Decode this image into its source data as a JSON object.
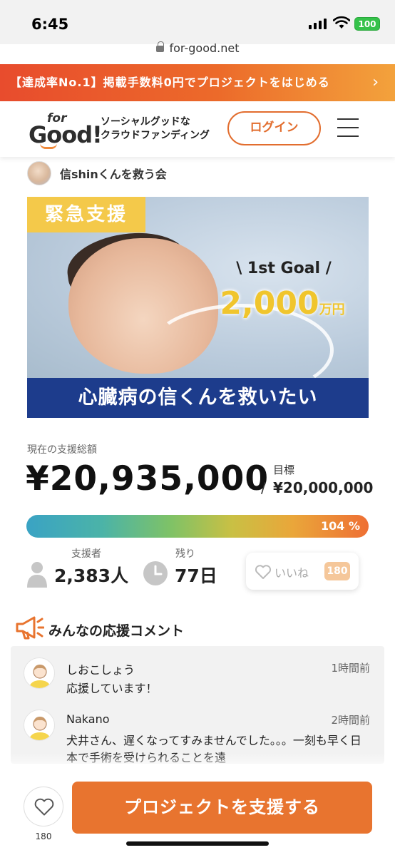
{
  "status_bar": {
    "time": "6:45",
    "battery": "100"
  },
  "browser": {
    "url": "for-good.net"
  },
  "promo": {
    "text": "【達成率No.1】掲載手数料0円でプロジェクトをはじめる",
    "chevron": "›"
  },
  "header": {
    "logo_for": "for",
    "logo_good": "Good!",
    "tagline_1": "ソーシャルグッドな",
    "tagline_2": "クラウドファンディング",
    "login_label": "ログイン"
  },
  "project": {
    "owner": "信shinくんを救う会",
    "hero": {
      "badge": "緊急支援",
      "goal_label": "\\ 1st Goal /",
      "goal_amount": "2,000",
      "goal_unit": "万円",
      "caption": "心臓病の信くんを救いたい"
    },
    "total_label": "現在の支援総額",
    "total_amount": "¥20,935,000",
    "slash": "/",
    "goal_label": "目標",
    "goal_amount": "¥20,000,000",
    "progress_percent": 104,
    "progress_text": "104 %",
    "supporters_label": "支援者",
    "supporters_value": "2,383人",
    "remaining_label": "残り",
    "remaining_value": "77日",
    "like_label": "いいね",
    "like_count": "180"
  },
  "comments": {
    "title": "みんなの応援コメント",
    "items": [
      {
        "name": "しおこしょう",
        "time": "1時間前",
        "text": "応援しています！"
      },
      {
        "name": "Nakano",
        "time": "2時間前",
        "text": "犬井さん、遅くなってすみませんでした。。。一刻も早く日本で手術を受けられることを遠"
      }
    ]
  },
  "bottom": {
    "heart_count": "180",
    "support_label": "プロジェクトを支援する"
  },
  "colors": {
    "accent": "#e8742f",
    "promo": "#e84c2d",
    "navy": "#1d3c8c",
    "gold": "#f0c52d"
  }
}
